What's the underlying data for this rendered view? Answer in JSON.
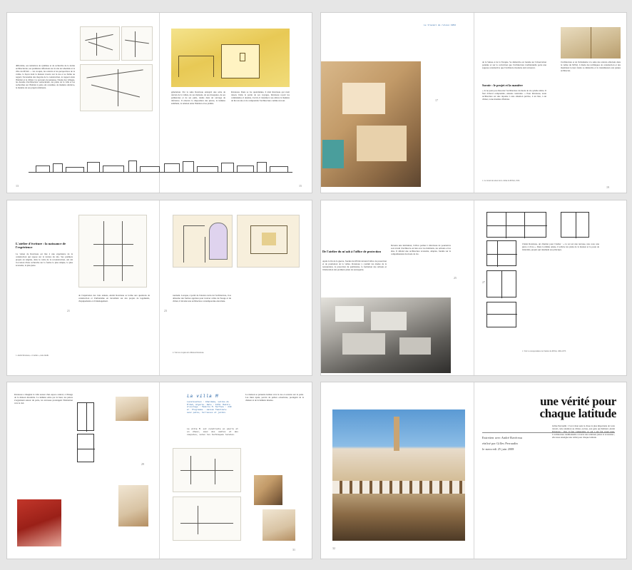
{
  "spread1": {
    "text_lead": "difficultés, ses tentatives de synthèse et de recherche de la forme architecturale, ses premières réflexions sur le site de Ghardaïa et la ville du M'Zab — les croquis, les relevés et les perspectives de la vallée, la façon dont la maison s'ouvre sur la rue et se ferme au regard, l'économie des moyens de la construction, le rapport entre l'habitat et le climat. Ce parcours de jeunesse, l'étude des villages, les dessins d'architecture vernaculaire, les plans de la ville et les recherches sur l'habitat à patio ont constitué, de manière décisive, la matière de ses projets ultérieurs.",
    "text_mid": "génération. Par la suite Ravéreau entreprit une série de relevés de la vallée, de ses maisons, de ses mosquées, de ses palmeraies et de ses puits, réunis dans un ouvrage de référence. Il observe la disposition des pièces, la lumière zénithale, la relation entre l'habitat et les jardins.",
    "text_right": "Ravéreau. Dans sa vie quotidienne, il était Ravéreau qui avait raison. Dans la partie de ses voyages, Ravéreau reçoit les commandes, il dessine, il écrit, il transmet à ses élèves la manière de lire un site et de comprendre l'architecture comme un tout.",
    "page_left": "13",
    "page_right": "15"
  },
  "spread2": {
    "running_head": "Le travail de relevé 1952",
    "text_main": "de la Suisse et de la Turquie. Sa démarche est fondée sur l'observation patiente et sur la conviction que l'architecture traditionnelle porte une sagesse constructive que l'architecte moderne doit retrouver.",
    "subhead": "Savoir : le projet et la manière",
    "text_body": "« Je ne peux pas dissocier l'architecture du mode de vie qu'elle abrite. Il faut d'abord comprendre, ensuite construire. » Pour Ravéreau, toute architecture est une réponse à une situation précise, à un lieu, à un climat, à une manière d'habiter.",
    "text_right": "l'architecture et de l'urbanisme à la suite des relevés effectués dans la vallée du M'Zab. L'étude des techniques de construction et des matériaux locaux fonde sa démarche et la transmission aux jeunes architectes.",
    "page_left": "17",
    "page_right": "19",
    "footnote": "1. Le travail de relevé de la vallée du M'Zab, 1952."
  },
  "spread3": {
    "heading": "L'atelier d'écriture : la naissance de l'expérience",
    "text_left": "La vision de Ravéreau est liée à une expérience de la construction qui repose sur la lecture du site. Ses premiers projets en Algérie, dans le cadre de la reconstruction, ont été l'occasion d'une recherche sur la forme la plus simple, la plus économe, la plus juste.",
    "text_mid": "de l'expérience des trois années, André Ravéreau se forme aux questions de construction et d'urbanisme en travaillant sur des projets de logements, d'équipements et d'aménagement.",
    "text_right": "tournant. Lorsque, à partir de l'ancien cercle de l'architecture, il se détourne des formes apprises pour trouver celles de l'usage et du climat, il invente une architecture contemporaine enracinée.",
    "page_left": "21",
    "page_right": "23",
    "footnote_left": "1. André Ravéreau, « L'atelier », texte inédit.",
    "footnote_right": "2. Voir les croquis de la Maison Ravéreau."
  },
  "spread4": {
    "heading": "De l'atelier du m'zab à l'office de protection",
    "text_left": "Après la fin de la guerre, l'atelier du M'Zab devient l'office de protection et de promotion de la vallée. Ravéreau y conduit les études de la restauration, la protection du patrimoine, la formation des artisans et l'élaboration des premiers plans de sauvegarde.",
    "text_mid": "Devenu une institution, l'office permet à Ravéreau de poursuivre son travail d'architecte en lien avec les habitants, les artisans et les élus. Il défend une architecture économe, adaptée, fondée sur la compréhension du mode de vie.",
    "text_right": "Chalet Ravéreau, un chantier pour l'atelier : « le sol est une terrasse, une cour, une pièce à vivre ». Dans la même année, il achève les plans de la maison et la poste de Ghardaïa, projets qui résument ses principes.",
    "page_left": "25",
    "page_right": "27",
    "footnote": "1. Voir la correspondance de l'atelier du M'Zab, 1962-1973."
  },
  "spread5": {
    "villa_title": "La villa M",
    "villa_caption": "Localisation : Ghardaïa, vallée du M'Zab, Algérie. Date : 1970. Maître d'ouvrage : famille M. Surface : 240 m². Programme : maison familiale avec patio, terrasses et jardin.",
    "text_left": "Ravéreau a imaginé la villa autour d'un espace central, à l'image de la maison mozabite. La lumière entre par le haut, les pièces s'organisent autour du patio, les terrasses prolongent l'habitation vers le ciel.",
    "text_mid": "La villa M. est construite en pierre et en chaux, avec des voûtes et des coupoles, selon les techniques locales.",
    "text_right": "La maison se présente fermée vers la rue et ouverte sur le patio. Les murs épais, percés de petites ouvertures, protègent de la chaleur et de la lumière intense.",
    "page_left": "29",
    "page_right": "31"
  },
  "spread6": {
    "title": "une vérité pour chaque latitude",
    "byline_lead": "Entretien avec André Ravéreau",
    "byline_by": "réalisé par Gilles Perraudin",
    "byline_date": "le mercredi 25 juin 2008",
    "interview_text": "Gilles Perraudin : C'est à mon sens la chose la plus importante de votre travail, cette attention au climat, au lieu, aux gens qui habitent. André Ravéreau : Oui, il faut comprendre ce qui a été fait avant nous. L'architecture traditionnelle a trouvé des solutions justes et économes ; elle nous enseigne une vérité pour chaque latitude.",
    "page_left": "32"
  }
}
